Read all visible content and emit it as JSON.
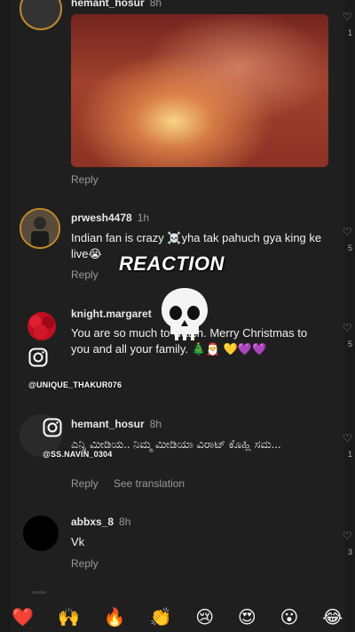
{
  "comments": [
    {
      "username": "hemant_hosur",
      "time": "8h",
      "action": "Reply"
    },
    {
      "username": "prwesh4478",
      "time": "1h",
      "text": "Indian fan is crazy ☠️yha tak pahuch gya king ke live😭",
      "action": "Reply"
    },
    {
      "username": "knight.margaret",
      "time": "",
      "text": "You are so much to watch. Merry Christmas to you and all your family. 🎄🎅 💛💜💜",
      "action": "Reply"
    },
    {
      "username": "hemant_hosur",
      "time": "8h",
      "text": "ಎನ್ನಿ ಮೀಡಿಯ.. ನಿಮ್ಮ ಮೀಡಿಯಾ ವಿರಾಟ್ ಕೊಹ್ಲಿ ಸಮ...",
      "action": "Reply",
      "translate": "See translation"
    },
    {
      "username": "abbxs_8",
      "time": "8h",
      "text": "Vk",
      "action": "Reply"
    }
  ],
  "overlay": {
    "reaction": "REACTION",
    "watermark1": "@UNIQUE_THAKUR076",
    "watermark2": "@SS.NAVIN_0304"
  },
  "side_counts": [
    "1",
    "5",
    "5",
    "1",
    "3"
  ],
  "emoji_reactions": [
    "❤️",
    "🙌",
    "🔥",
    "👏",
    "😢",
    "😍",
    "😮",
    "😂"
  ],
  "colors": {
    "background": "#1f1f1f",
    "avatar_ring": "#c08a2b",
    "muted_text": "#9a9a9a"
  }
}
